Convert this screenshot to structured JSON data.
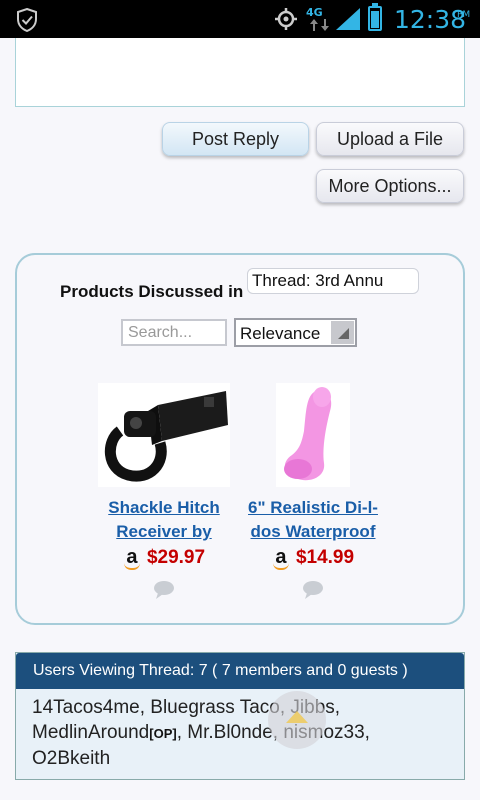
{
  "status_bar": {
    "network_label": "4G",
    "time": "12:38",
    "ampm": "PM",
    "battery_level": 0.8,
    "icons": [
      "shield-check-icon",
      "gps-icon",
      "network-4g-icon",
      "signal-icon",
      "battery-icon"
    ],
    "accent_color": "#33b5e5"
  },
  "reply": {
    "post_reply": "Post Reply",
    "upload_file": "Upload a File",
    "more_options": "More Options..."
  },
  "products": {
    "title": "Products Discussed in",
    "thread_selector_value": "Thread: 3rd Annu",
    "search_placeholder": "Search...",
    "sort_value": "Relevance",
    "items": [
      {
        "name_line1": "Shackle Hitch",
        "name_line2": "Receiver by",
        "price": "$29.97",
        "store_icon": "amazon-icon",
        "image_icon": "shackle-hitch-image"
      },
      {
        "name_line1": "6\" Realistic Di-l-",
        "name_line2": "dos Waterproof",
        "price": "$14.99",
        "store_icon": "amazon-icon",
        "image_icon": "product-image"
      }
    ],
    "colors": {
      "link": "#1a5ea8",
      "price": "#c40000"
    }
  },
  "users": {
    "header": "Users Viewing Thread: 7 ( 7 members and 0 guests )",
    "line1": "14Tacos4me, Bluegrass Taco, Jibbs,",
    "line2_name": "MedlinAround",
    "op_tag": "[OP]",
    "line2_rest": ", Mr.Bl0nde, nismoz33,",
    "line3": "O2Bkeith",
    "header_color": "#1c4f7d"
  }
}
